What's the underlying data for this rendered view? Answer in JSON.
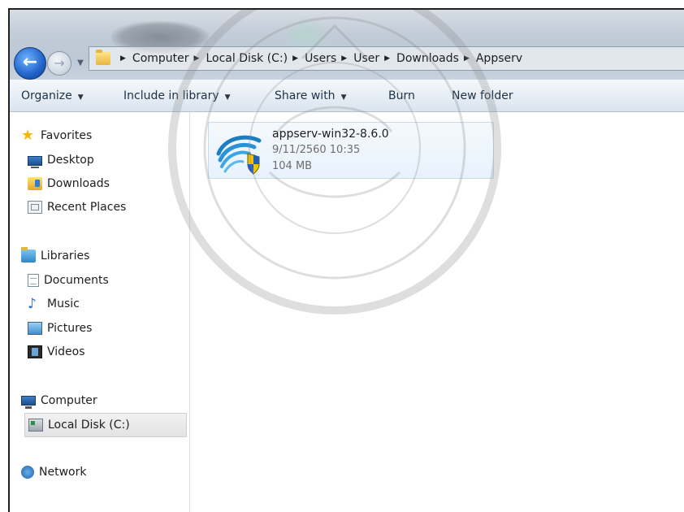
{
  "window": {
    "breadcrumbs": [
      "Computer",
      "Local Disk (C:)",
      "Users",
      "User",
      "Downloads",
      "Appserv"
    ]
  },
  "toolbar": {
    "organize": "Organize",
    "include_in_library": "Include in library",
    "share_with": "Share with",
    "burn": "Burn",
    "new_folder": "New folder"
  },
  "sidebar": {
    "favorites": {
      "label": "Favorites",
      "items": [
        "Desktop",
        "Downloads",
        "Recent Places"
      ]
    },
    "libraries": {
      "label": "Libraries",
      "items": [
        "Documents",
        "Music",
        "Pictures",
        "Videos"
      ]
    },
    "computer": {
      "label": "Computer",
      "items": [
        "Local Disk (C:)"
      ],
      "selected": "Local Disk (C:)"
    },
    "network": {
      "label": "Network"
    }
  },
  "files": [
    {
      "name": "appserv-win32-8.6.0",
      "date": "9/11/2560 10:35",
      "size": "104 MB"
    }
  ],
  "icons": {
    "back": "back-arrow-icon",
    "forward": "forward-arrow-icon",
    "installer": "appserv-installer-icon",
    "uac_shield": "uac-shield-icon"
  },
  "colors": {
    "selection_bg": "#e8f2fb",
    "selection_border": "#c4dbf0",
    "toolbar_bg": "#e6edf5",
    "watermark": "#8a8a8a"
  }
}
